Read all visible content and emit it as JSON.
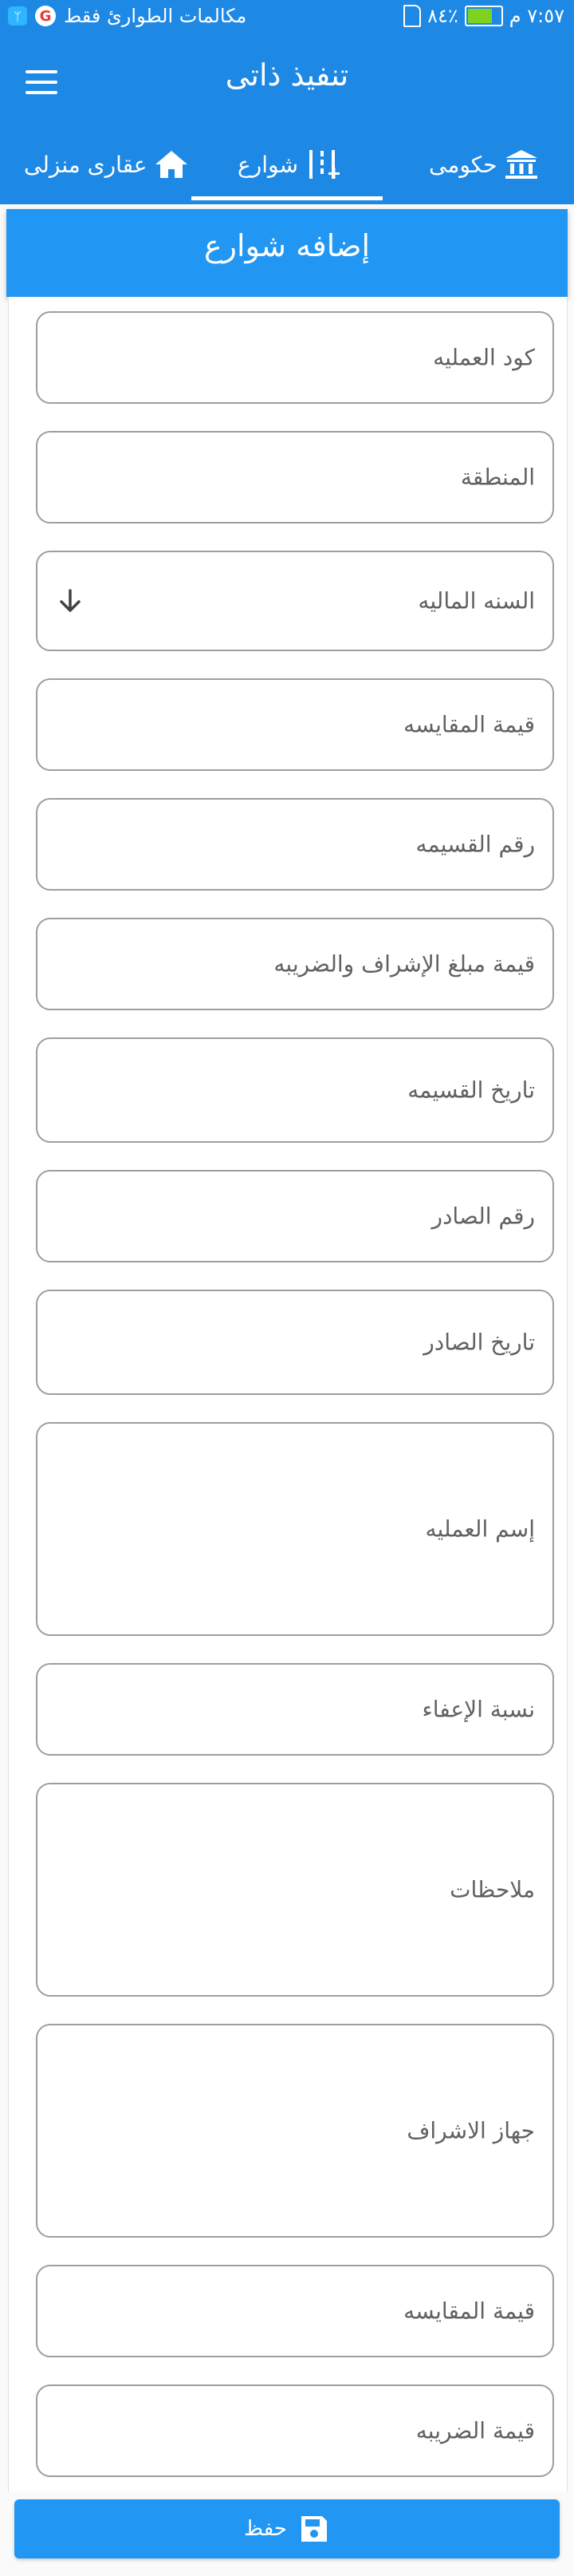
{
  "status_bar": {
    "carrier_text": "مكالمات الطوارئ فقط",
    "g_badge": "G",
    "time": "٧:٥٧ م",
    "battery_percent": "٨٤٪",
    "battery_level": 0.84
  },
  "app_bar": {
    "title": "تنفيذ ذاتى"
  },
  "tabs": [
    {
      "label": "حكومى",
      "icon": "government-building-icon"
    },
    {
      "label": "شوارع",
      "icon": "street-icon",
      "selected": true
    },
    {
      "label": "عقارى منزلى",
      "icon": "home-icon"
    }
  ],
  "section": {
    "title": "إضافه شوارع"
  },
  "fields": [
    {
      "label": "كود العمليه"
    },
    {
      "label": "المنطقة"
    },
    {
      "label": "السنه الماليه",
      "type": "dropdown"
    },
    {
      "label": "قيمة المقايسه"
    },
    {
      "label": "رقم القسيمه"
    },
    {
      "label": "قيمة مبلغ الإشراف والضريبه"
    },
    {
      "label": "تاريخ القسيمه"
    },
    {
      "label": "رقم الصادر"
    },
    {
      "label": "تاريخ الصادر"
    },
    {
      "label": "إسم العمليه",
      "multiline": true
    },
    {
      "label": "نسبة الإعفاء"
    },
    {
      "label": "ملاحظات",
      "multiline": true
    },
    {
      "label": "جهاز الاشراف",
      "multiline": true
    },
    {
      "label": "قيمة المقايسه"
    },
    {
      "label": "قيمة الضريبه"
    }
  ],
  "save_button": {
    "label": "حفظ",
    "icon": "save-icon"
  },
  "colors": {
    "primary": "#1e88e5",
    "header": "#2196f3",
    "field_border": "#9e9e9e",
    "label": "#616161"
  }
}
